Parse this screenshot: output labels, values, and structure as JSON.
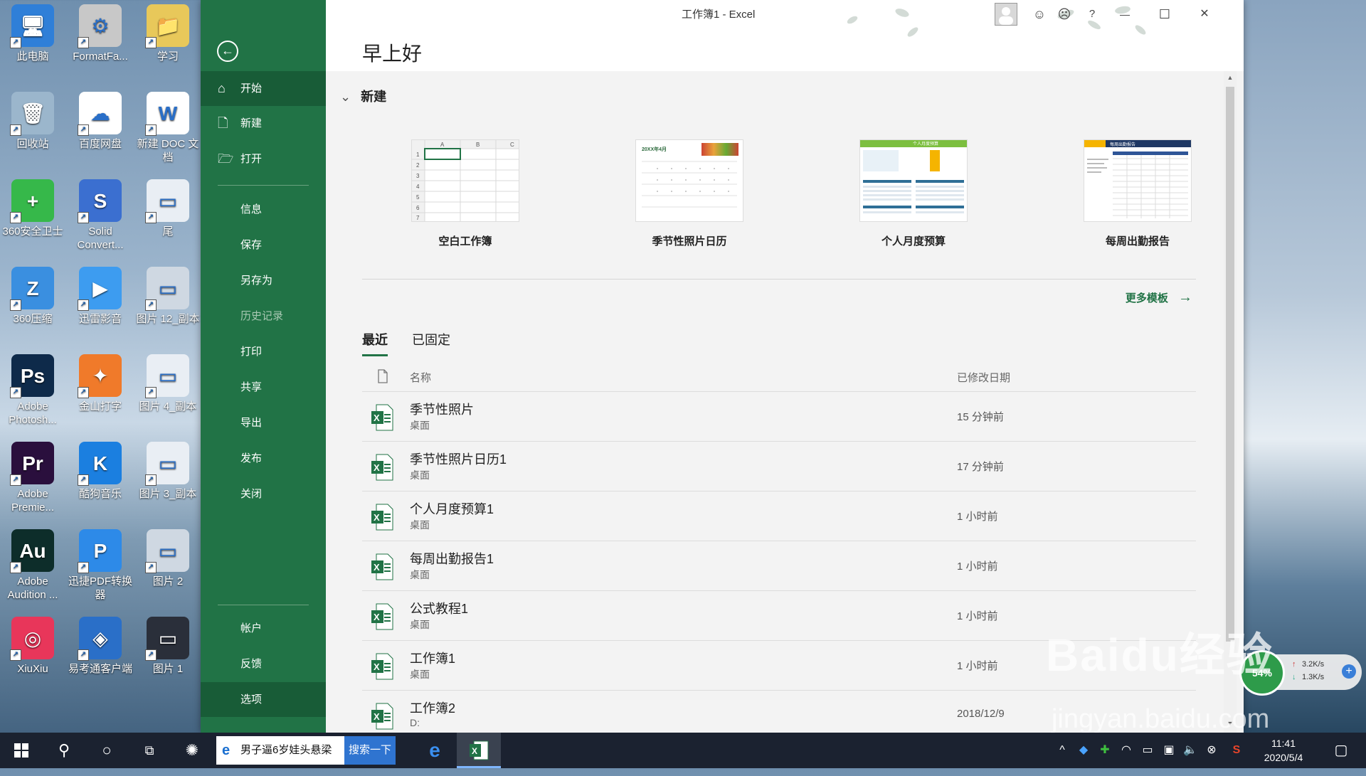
{
  "desktop": {
    "icons": [
      {
        "label": "此电脑",
        "color": "#2f7fd8",
        "glyph": "🖥"
      },
      {
        "label": "FormatFa...",
        "color": "#c8c8c8",
        "glyph": "⚙"
      },
      {
        "label": "学习",
        "color": "#e8c85a",
        "glyph": "📁"
      },
      {
        "label": "回收站",
        "color": "#9bb6cc",
        "glyph": "🗑"
      },
      {
        "label": "百度网盘",
        "color": "#ffffff",
        "glyph": "☁"
      },
      {
        "label": "新建 DOC 文档",
        "color": "#ffffff",
        "glyph": "W"
      },
      {
        "label": "360安全卫士",
        "color": "#36b84a",
        "glyph": "+"
      },
      {
        "label": "Solid Convert...",
        "color": "#3b6fd0",
        "glyph": "S"
      },
      {
        "label": "尾",
        "color": "#e9eef4",
        "glyph": "▭"
      },
      {
        "label": "360压缩",
        "color": "#3a8fe0",
        "glyph": "Z"
      },
      {
        "label": "迅雷影音",
        "color": "#3d9cf0",
        "glyph": "▶"
      },
      {
        "label": "图片 12_副本",
        "color": "#cfd8e2",
        "glyph": "▭"
      },
      {
        "label": "Adobe Photosh...",
        "color": "#0e2a4a",
        "glyph": "Ps"
      },
      {
        "label": "金山打字",
        "color": "#f07a2a",
        "glyph": "✦"
      },
      {
        "label": "图片 4_副本",
        "color": "#e9eef4",
        "glyph": "▭"
      },
      {
        "label": "Adobe Premie...",
        "color": "#2a0f3d",
        "glyph": "Pr"
      },
      {
        "label": "酷狗音乐",
        "color": "#1b7fe0",
        "glyph": "K"
      },
      {
        "label": "图片 3_副本",
        "color": "#e9eef4",
        "glyph": "▭"
      },
      {
        "label": "Adobe Audition ...",
        "color": "#0d2d2a",
        "glyph": "Au"
      },
      {
        "label": "迅捷PDF转换器",
        "color": "#2d8ae8",
        "glyph": "P"
      },
      {
        "label": "图片 2",
        "color": "#cfd8e2",
        "glyph": "▭"
      },
      {
        "label": "XiuXiu",
        "color": "#e8365a",
        "glyph": "◎"
      },
      {
        "label": "易考通客户端",
        "color": "#2a6fc8",
        "glyph": "◈"
      },
      {
        "label": "图片 1",
        "color": "#2a2f3a",
        "glyph": "▭"
      }
    ]
  },
  "excel": {
    "window_title": "工作簿1  -  Excel",
    "greeting": "早上好",
    "accent": "#217346",
    "sidebar": {
      "back_icon": "←",
      "items": [
        {
          "label": "开始",
          "icon": "⌂"
        },
        {
          "label": "新建",
          "icon": "🗋"
        },
        {
          "label": "打开",
          "icon": "🗁"
        },
        {
          "label": "信息"
        },
        {
          "label": "保存"
        },
        {
          "label": "另存为"
        },
        {
          "label": "历史记录"
        },
        {
          "label": "打印"
        },
        {
          "label": "共享"
        },
        {
          "label": "导出"
        },
        {
          "label": "发布"
        },
        {
          "label": "关闭"
        },
        {
          "label": "帐户"
        },
        {
          "label": "反馈"
        },
        {
          "label": "选项"
        }
      ]
    },
    "new_section": {
      "heading": "新建",
      "templates": [
        {
          "label": "空白工作簿"
        },
        {
          "label": "季节性照片日历",
          "thumb_text": "20XX年4月"
        },
        {
          "label": "个人月度预算",
          "thumb_text": "个人月度预算"
        },
        {
          "label": "每周出勤报告",
          "thumb_text": "每周出勤报告"
        }
      ],
      "more_templates": "更多模板",
      "more_arrow": "→"
    },
    "recent": {
      "tabs": [
        "最近",
        "已固定"
      ],
      "col_name": "名称",
      "col_date": "已修改日期",
      "files": [
        {
          "name": "季节性照片",
          "location": "桌面",
          "modified": "15 分钟前"
        },
        {
          "name": "季节性照片日历1",
          "location": "桌面",
          "modified": "17 分钟前"
        },
        {
          "name": "个人月度预算1",
          "location": "桌面",
          "modified": "1 小时前"
        },
        {
          "name": "每周出勤报告1",
          "location": "桌面",
          "modified": "1 小时前"
        },
        {
          "name": "公式教程1",
          "location": "桌面",
          "modified": "1 小时前"
        },
        {
          "name": "工作簿1",
          "location": "桌面",
          "modified": "1 小时前"
        },
        {
          "name": "工作簿2",
          "location": "D:",
          "modified": "2018/12/9"
        }
      ]
    },
    "titlebar_icons": [
      "smile-icon",
      "frown-icon",
      "help-icon",
      "minimize-icon",
      "maximize-icon",
      "close-icon"
    ],
    "titlebar_glyphs": {
      "smile": "☺",
      "frown": "☹",
      "help": "?",
      "min": "—",
      "max": "☐",
      "close": "✕"
    }
  },
  "taskbar": {
    "search_text": "男子逼6岁娃头悬梁",
    "search_button": "搜索一下",
    "clock_time": "11:41",
    "clock_date": "2020/5/4"
  },
  "net_widget": {
    "up": "3.2K/s",
    "down": "1.3K/s",
    "percent": "54%"
  },
  "watermark": {
    "text": "Baidu经验",
    "url": "jingyan.baidu.com"
  }
}
